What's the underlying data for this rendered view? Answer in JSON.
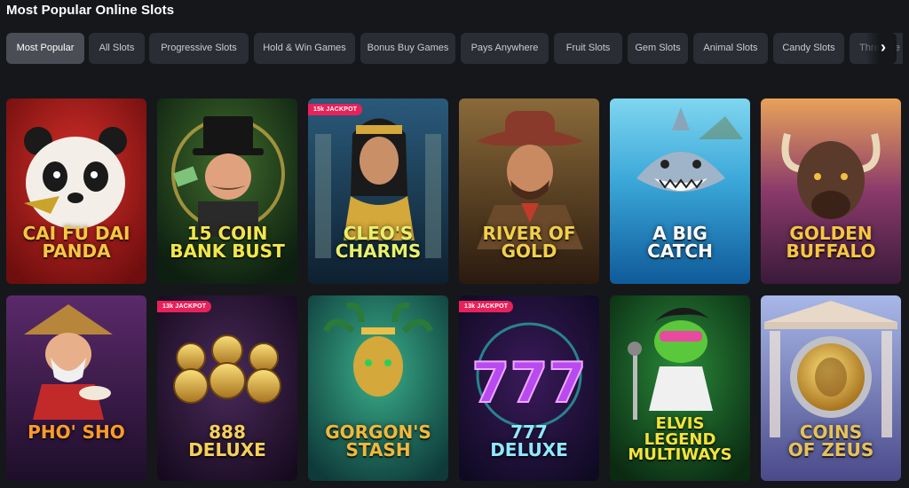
{
  "page_title": "Most Popular Online Slots",
  "tabs": [
    {
      "label": "Most Popular",
      "active": true
    },
    {
      "label": "All Slots"
    },
    {
      "label": "Progressive Slots"
    },
    {
      "label": "Hold & Win Games"
    },
    {
      "label": "Bonus Buy Games"
    },
    {
      "label": "Pays Anywhere"
    },
    {
      "label": "Fruit Slots"
    },
    {
      "label": "Gem Slots"
    },
    {
      "label": "Animal Slots"
    },
    {
      "label": "Candy Slots"
    },
    {
      "label": "Three Re"
    }
  ],
  "scroll_arrow": "›",
  "games": [
    {
      "name": "CAI FU DAI\nPANDA",
      "badge": "",
      "title_color": "#f4c842"
    },
    {
      "name": "15 COIN\nBANK BUST",
      "badge": "",
      "title_color": "#f2e64a"
    },
    {
      "name": "CLEO'S\nCHARMS",
      "badge": "15k JACKPOT",
      "title_color": "#e8f06a"
    },
    {
      "name": "RIVER OF\nGOLD",
      "badge": "",
      "title_color": "#f2cf4a"
    },
    {
      "name": "A BIG\nCATCH",
      "badge": "",
      "title_color": "#ffffff"
    },
    {
      "name": "GOLDEN\nBUFFALO",
      "badge": "",
      "title_color": "#f7c640"
    },
    {
      "name": "PHO' SHO",
      "badge": "",
      "title_color": "#ff9a2a"
    },
    {
      "name": "888\nDELUXE",
      "badge": "13k JACKPOT",
      "title_color": "#f5d05a"
    },
    {
      "name": "GORGON'S\nSTASH",
      "badge": "",
      "title_color": "#f2b83a"
    },
    {
      "name": "777\nDELUXE",
      "badge": "13k JACKPOT",
      "title_color": "#8fe8ff"
    },
    {
      "name": "ELVIS\nLEGEND\nMULTIWAYS",
      "badge": "",
      "title_color": "#f4e33a"
    },
    {
      "name": "COINS\nOF ZEUS",
      "badge": "",
      "title_color": "#e6c15a"
    }
  ]
}
